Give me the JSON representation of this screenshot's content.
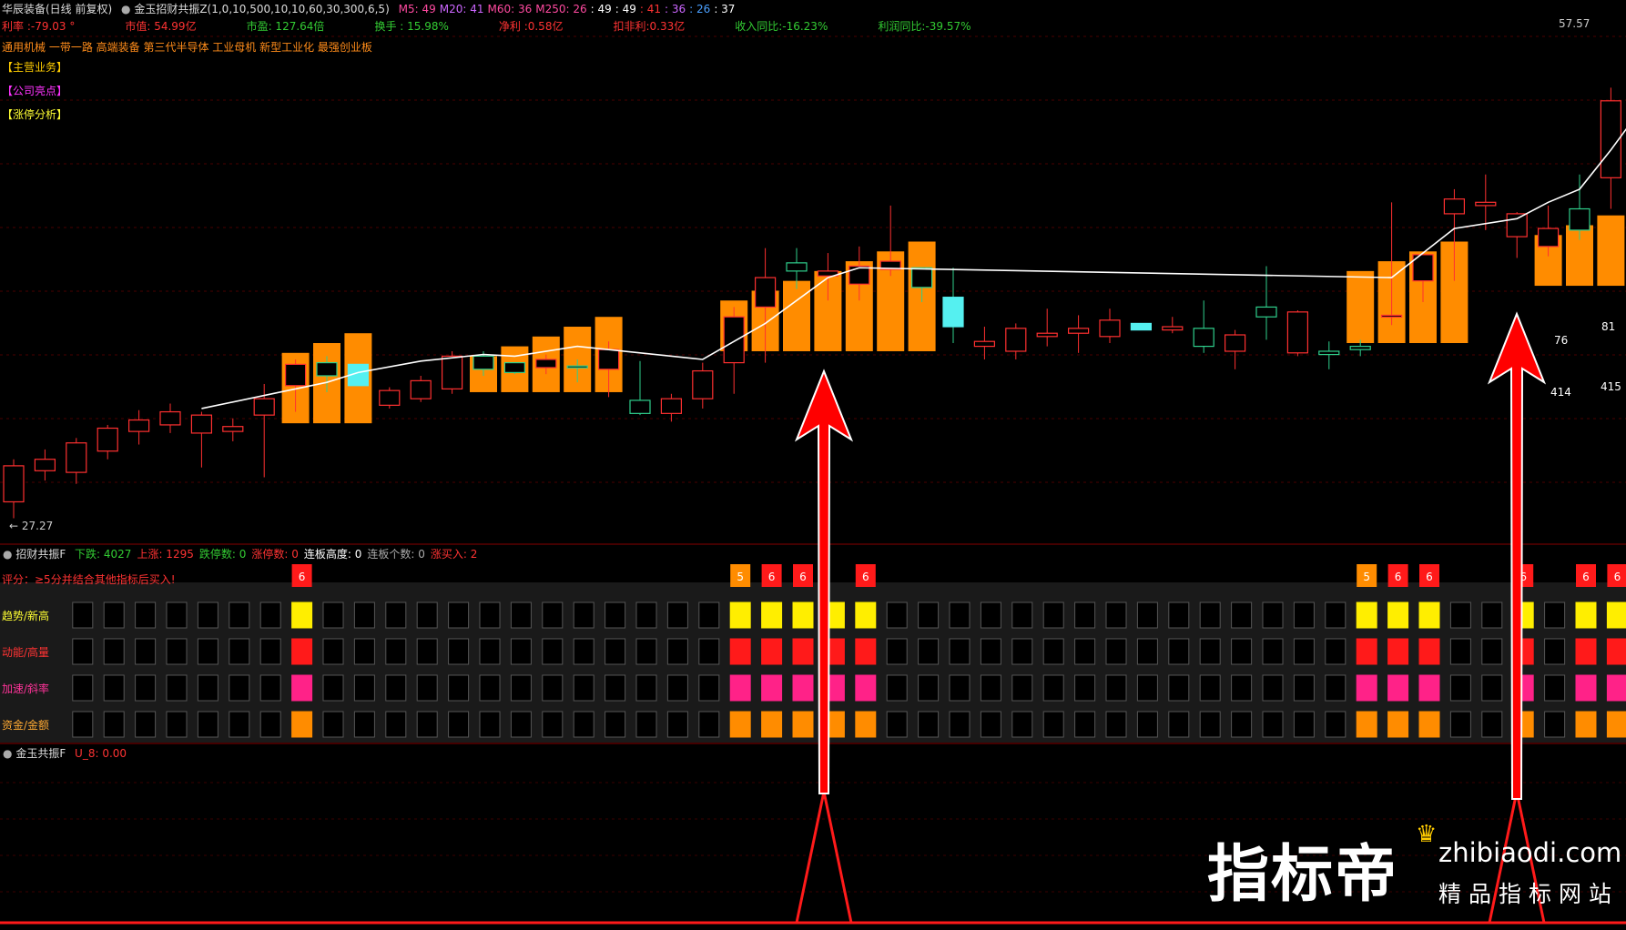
{
  "header": {
    "stock": "华辰装备(日线 前复权)",
    "indicator": "金玉招财共振Z(1,0,10,500,10,10,60,30,300,6,5)",
    "ma": [
      {
        "label": "M5: 49",
        "color": "#ff4aa0"
      },
      {
        "label": "M20: 41",
        "color": "#cc66ff"
      },
      {
        "label": "M60: 36",
        "color": "#ff4aa0"
      },
      {
        "label": "M250: 26",
        "color": "#ff4aa0"
      },
      {
        "label": ": 49",
        "color": "#ffffff"
      },
      {
        "label": ": 49",
        "color": "#ffffff"
      },
      {
        "label": ": 41",
        "color": "#ff3333"
      },
      {
        "label": ": 36",
        "color": "#cc66ff"
      },
      {
        "label": ": 26",
        "color": "#4aa0ff"
      },
      {
        "label": ": 37",
        "color": "#ffffff"
      }
    ]
  },
  "fundamentals": [
    {
      "label": "利率 :-79.03 °",
      "color": "#ff3333"
    },
    {
      "label": "市值: 54.99亿",
      "color": "#ff3333"
    },
    {
      "label": "市盈: 127.64倍",
      "color": "#33cc33"
    },
    {
      "label": "换手 : 15.98%",
      "color": "#33cc33"
    },
    {
      "label": "净利 :0.58亿",
      "color": "#ff3333"
    },
    {
      "label": "扣非利:0.33亿",
      "color": "#ff3333"
    },
    {
      "label": "收入同比:-16.23%",
      "color": "#33cc33"
    },
    {
      "label": "利润同比:-39.57%",
      "color": "#33cc33"
    }
  ],
  "concepts": "通用机械 一带一路 高端装备 第三代半导体 工业母机 新型工业化 最强创业板",
  "tags": [
    {
      "label": "【主营业务】",
      "color": "#ffcc00"
    },
    {
      "label": "【公司亮点】",
      "color": "#ff33ff"
    },
    {
      "label": "【涨停分析】",
      "color": "#ffff33"
    }
  ],
  "price_high_label": "57.57",
  "price_low_label": "← 27.27",
  "box_labels": [
    "76",
    "81",
    "414",
    "415"
  ],
  "panel2": {
    "name": "招财共振F",
    "stats": [
      {
        "label": "下跌: 4027",
        "color": "#33cc33"
      },
      {
        "label": "上涨: 1295",
        "color": "#ff3333"
      },
      {
        "label": "跌停数: 0",
        "color": "#33cc33"
      },
      {
        "label": "涨停数: 0",
        "color": "#ff3333"
      },
      {
        "label": "连板高度: 0",
        "color": "#ffffff"
      },
      {
        "label": "连板个数: 0",
        "color": "#aaaaaa"
      },
      {
        "label": "涨买入: 2",
        "color": "#ff3333"
      }
    ],
    "note": "评分：≥5分并结合其他指标后买入!",
    "rows": [
      "趋势/新高",
      "动能/高量",
      "加速/斜率",
      "资金/金额"
    ],
    "scores": [
      {
        "col": 9,
        "v": "6"
      },
      {
        "col": 23,
        "v": "5"
      },
      {
        "col": 24,
        "v": "6"
      },
      {
        "col": 25,
        "v": "6"
      },
      {
        "col": 27,
        "v": "6"
      },
      {
        "col": 43,
        "v": "5"
      },
      {
        "col": 44,
        "v": "6"
      },
      {
        "col": 45,
        "v": "6"
      },
      {
        "col": 48,
        "v": "6"
      },
      {
        "col": 50,
        "v": "6"
      },
      {
        "col": 51,
        "v": "6"
      }
    ]
  },
  "panel3": {
    "name": "金玉共振F",
    "value": "U_8: 0.00"
  },
  "watermark": {
    "brand": "指标帝",
    "site": "zhibiaodi.com",
    "slogan": "精品指标网站"
  },
  "chart_data": {
    "type": "candlestick",
    "ylim": [
      27.27,
      57.57
    ],
    "candles": [
      [
        28.3,
        30.9,
        27.3,
        30.5
      ],
      [
        30.2,
        31.5,
        29.6,
        30.9
      ],
      [
        30.1,
        32.2,
        29.4,
        31.9
      ],
      [
        31.4,
        33.0,
        30.9,
        32.8
      ],
      [
        32.6,
        33.9,
        31.8,
        33.3
      ],
      [
        33.0,
        34.3,
        32.5,
        33.8
      ],
      [
        32.5,
        33.8,
        30.4,
        33.6
      ],
      [
        32.6,
        33.4,
        32.0,
        32.9
      ],
      [
        33.6,
        35.5,
        29.8,
        34.6
      ],
      [
        35.4,
        37.0,
        33.8,
        36.7
      ],
      [
        36.8,
        37.2,
        35.0,
        36.0
      ],
      [
        36.7,
        35.4,
        35.4,
        35.4
      ],
      [
        34.2,
        35.3,
        34.0,
        35.1
      ],
      [
        34.6,
        36.0,
        34.4,
        35.7
      ],
      [
        35.2,
        37.5,
        34.9,
        37.2
      ],
      [
        37.2,
        37.5,
        36.0,
        36.4
      ],
      [
        36.8,
        36.8,
        36.1,
        36.2
      ],
      [
        36.5,
        37.3,
        36.1,
        37.0
      ],
      [
        36.6,
        37.0,
        35.6,
        36.5
      ],
      [
        36.4,
        38.1,
        34.7,
        37.6
      ],
      [
        34.5,
        36.9,
        33.6,
        33.7
      ],
      [
        33.7,
        34.9,
        33.2,
        34.6
      ],
      [
        34.6,
        36.8,
        34.0,
        36.3
      ],
      [
        36.8,
        40.2,
        34.9,
        39.6
      ],
      [
        40.2,
        43.8,
        36.8,
        42.0
      ],
      [
        42.9,
        43.8,
        41.3,
        42.4
      ],
      [
        42.1,
        43.5,
        40.6,
        42.4
      ],
      [
        41.6,
        43.9,
        40.6,
        42.7
      ],
      [
        42.5,
        46.4,
        42.1,
        43.0
      ],
      [
        42.6,
        42.6,
        40.5,
        41.4
      ],
      [
        40.8,
        42.6,
        38.0,
        39.0
      ],
      [
        37.8,
        39.0,
        37.0,
        38.1
      ],
      [
        37.5,
        39.2,
        37.0,
        38.9
      ],
      [
        38.4,
        40.1,
        37.8,
        38.6
      ],
      [
        38.6,
        39.7,
        37.4,
        38.9
      ],
      [
        38.4,
        40.1,
        38.0,
        39.4
      ],
      [
        39.2,
        38.8,
        38.8,
        38.8
      ],
      [
        38.8,
        39.6,
        38.6,
        39.0
      ],
      [
        38.9,
        40.6,
        37.4,
        37.8
      ],
      [
        37.5,
        38.8,
        36.4,
        38.5
      ],
      [
        40.2,
        42.7,
        38.2,
        39.6
      ],
      [
        37.4,
        40.0,
        37.2,
        39.9
      ],
      [
        37.5,
        38.1,
        36.4,
        37.3
      ],
      [
        37.8,
        38.2,
        37.2,
        37.6
      ],
      [
        39.7,
        46.6,
        39.1,
        39.7
      ],
      [
        41.8,
        42.9,
        40.5,
        43.4
      ],
      [
        45.9,
        47.4,
        41.8,
        46.8
      ],
      [
        46.4,
        48.3,
        44.9,
        46.6
      ],
      [
        44.5,
        46.0,
        43.2,
        45.9
      ],
      [
        43.9,
        46.4,
        43.3,
        45.0
      ],
      [
        46.2,
        48.3,
        44.3,
        44.9
      ],
      [
        48.1,
        53.6,
        46.2,
        52.8
      ],
      [
        52.7,
        57.2,
        53.6,
        55.2
      ],
      [
        55.4,
        57.6,
        51.8,
        57.0
      ]
    ],
    "ma_white": [
      [
        6,
        34.0
      ],
      [
        8,
        34.8
      ],
      [
        10,
        35.6
      ],
      [
        11,
        36.2
      ],
      [
        13,
        36.9
      ],
      [
        15,
        37.3
      ],
      [
        16,
        37.2
      ],
      [
        18,
        37.8
      ],
      [
        22,
        37.0
      ],
      [
        24,
        39.2
      ],
      [
        26,
        42.0
      ],
      [
        27,
        42.6
      ],
      [
        44,
        42.0
      ],
      [
        46,
        45.0
      ],
      [
        48,
        45.6
      ],
      [
        49,
        46.6
      ],
      [
        50,
        47.4
      ],
      [
        51,
        49.8
      ],
      [
        52,
        52.4
      ],
      [
        53,
        54.8
      ]
    ]
  }
}
